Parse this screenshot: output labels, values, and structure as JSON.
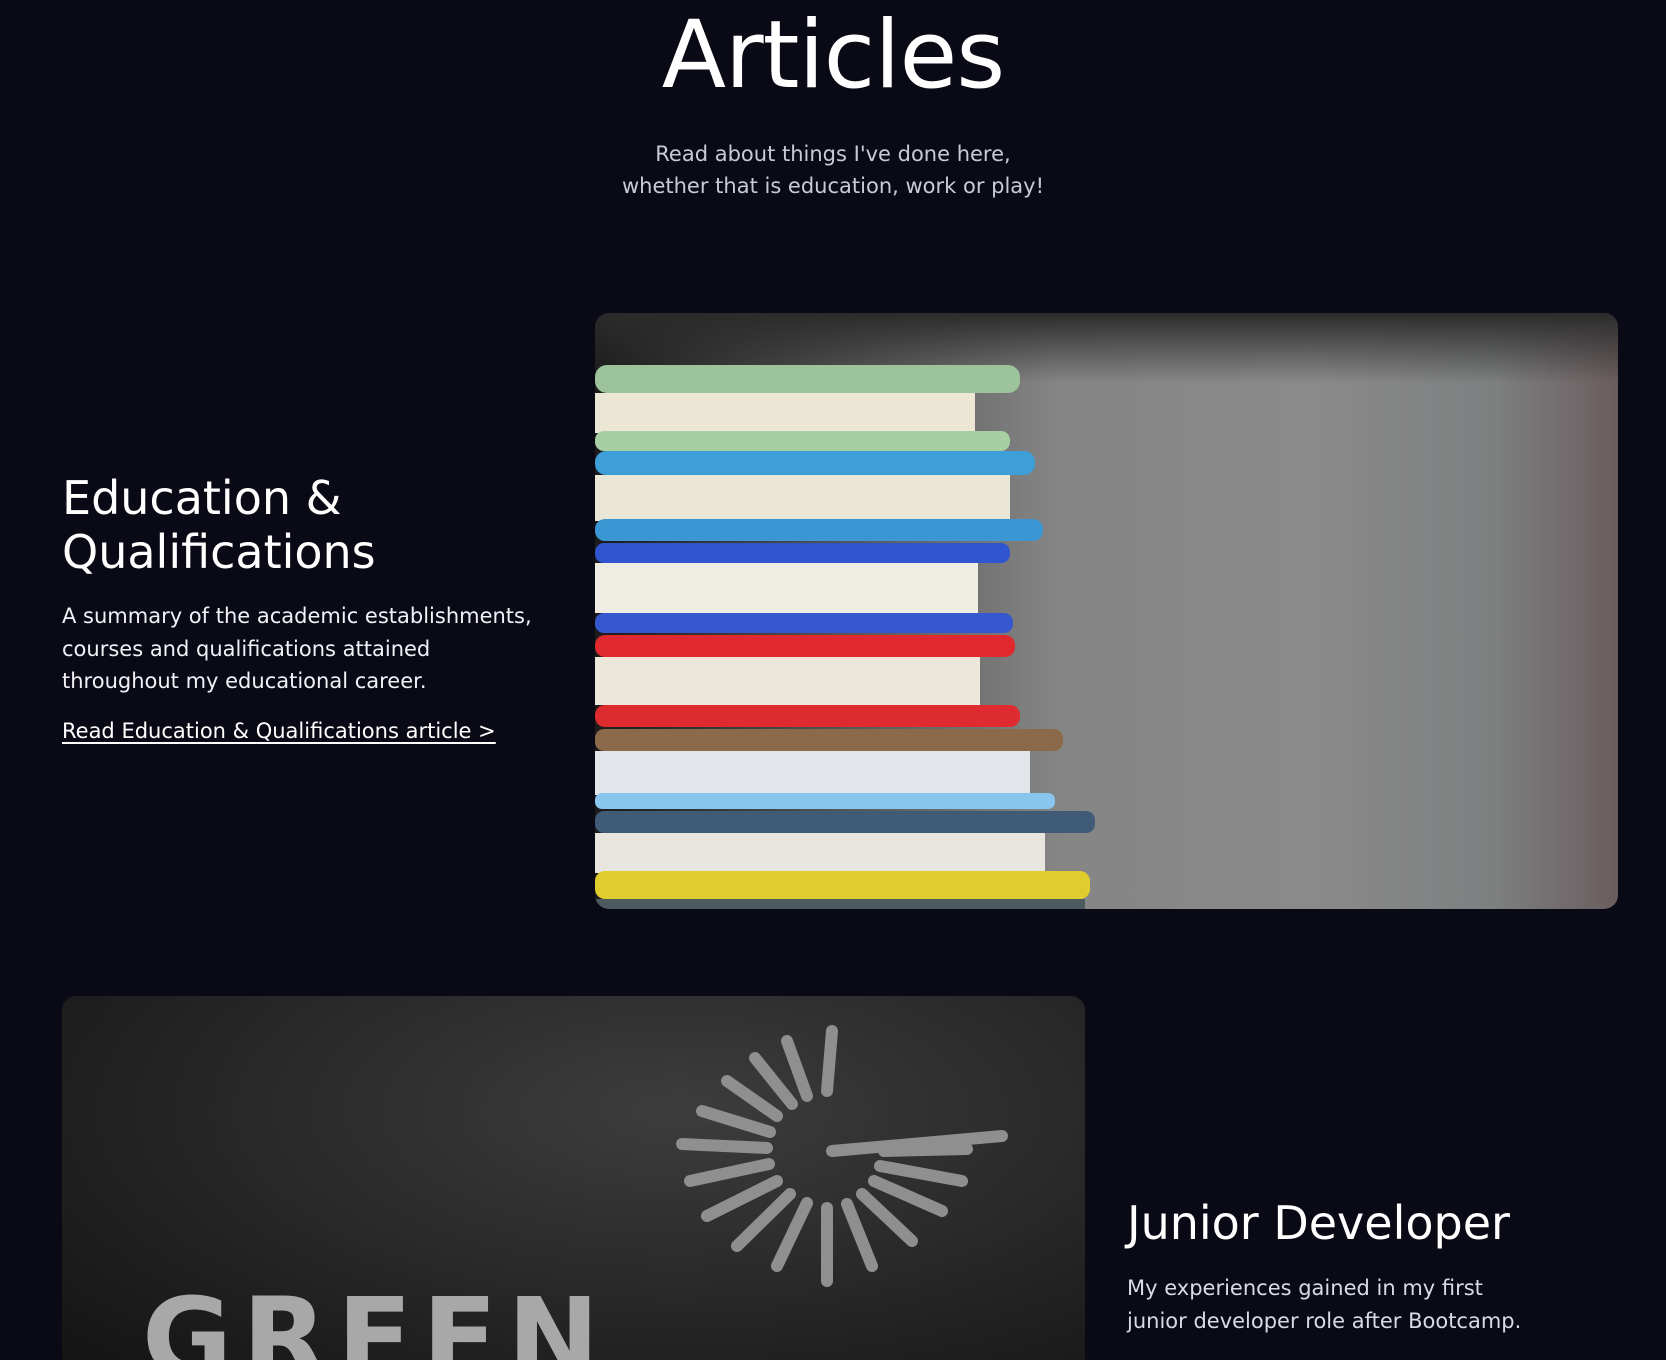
{
  "header": {
    "title": "Articles",
    "subtitle_line1": "Read about things I've done here,",
    "subtitle_line2": "whether that is education, work or play!"
  },
  "articles": [
    {
      "title_line1": "Education &",
      "title_line2": "Qualifications",
      "description": "A summary of the academic establishments, courses and qualifications attained throughout my educational career.",
      "link_label": "Read Education & Qualifications article >",
      "image": "stacked-books-photo"
    },
    {
      "title": "Junior Developer",
      "description": "My experiences gained in my first junior developer role after Bootcamp.",
      "image": "green-logo-sign-photo",
      "image_text": "GREEN"
    }
  ]
}
